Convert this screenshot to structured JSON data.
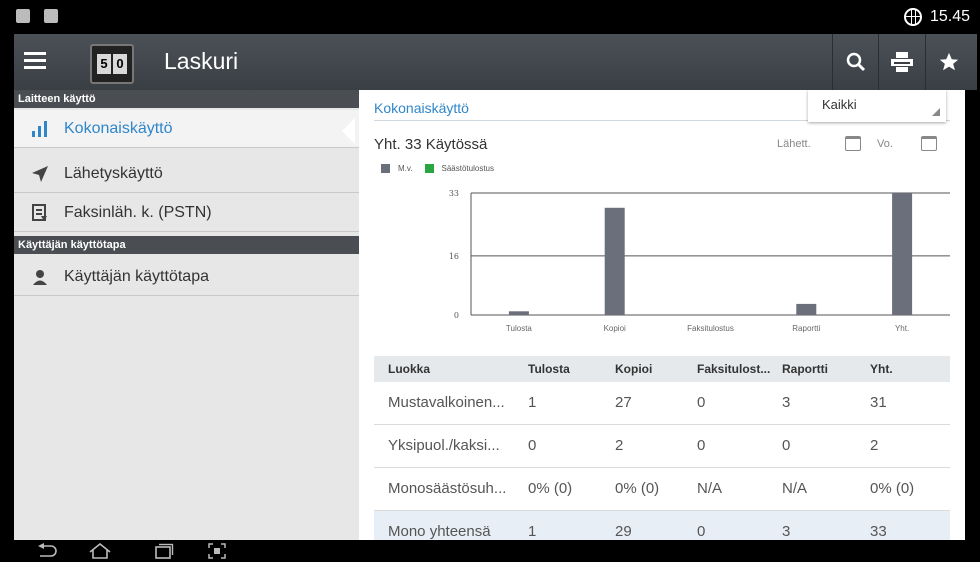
{
  "status": {
    "time": "15.45"
  },
  "app": {
    "title": "Laskuri",
    "logo_digits": [
      "5",
      "0"
    ]
  },
  "sidebar": {
    "sections": [
      {
        "header": "Laitteen käyttö",
        "items": [
          "Kokonaiskäyttö",
          "Lähetyskäyttö",
          "Faksinläh. k. (PSTN)"
        ]
      },
      {
        "header": "Käyttäjän käyttötapa",
        "items": [
          "Käyttäjän käyttötapa"
        ]
      }
    ],
    "active_item": "Kokonaiskäyttö"
  },
  "main": {
    "title": "Kokonaiskäyttö",
    "filter_value": "Kaikki",
    "total_line": "Yht. 33 Käytössä",
    "date_from_label": "Lähett.",
    "date_to_label": "Vo.",
    "legend": [
      "M.v.",
      "Säästötulostus"
    ]
  },
  "colors": {
    "accent": "#2f86c9",
    "series_mv": "#6b6f7c",
    "series_saving": "#2aa640"
  },
  "chart_data": {
    "type": "bar",
    "categories": [
      "Tulosta",
      "Kopioi",
      "Faksitulostus",
      "Raportti",
      "Yht."
    ],
    "series": [
      {
        "name": "M.v.",
        "values": [
          1,
          29,
          0,
          3,
          33
        ]
      },
      {
        "name": "Säästötulostus",
        "values": [
          0,
          0,
          0,
          0,
          0
        ]
      }
    ],
    "yticks": [
      0,
      16,
      33
    ],
    "ylim": [
      0,
      33
    ],
    "grid": true,
    "legend_position": "top-left"
  },
  "table": {
    "headers": [
      "Luokka",
      "Tulosta",
      "Kopioi",
      "Faksitulost...",
      "Raportti",
      "Yht."
    ],
    "rows": [
      [
        "Mustavalkoinen...",
        "1",
        "27",
        "0",
        "3",
        "31"
      ],
      [
        "Yksipuol./kaksi...",
        "0",
        "2",
        "0",
        "0",
        "2"
      ],
      [
        "Monosäästösuh...",
        "0% (0)",
        "0% (0)",
        "N/A",
        "N/A",
        "0% (0)"
      ],
      [
        "Mono yhteensä",
        "1",
        "29",
        "0",
        "3",
        "33"
      ]
    ]
  }
}
